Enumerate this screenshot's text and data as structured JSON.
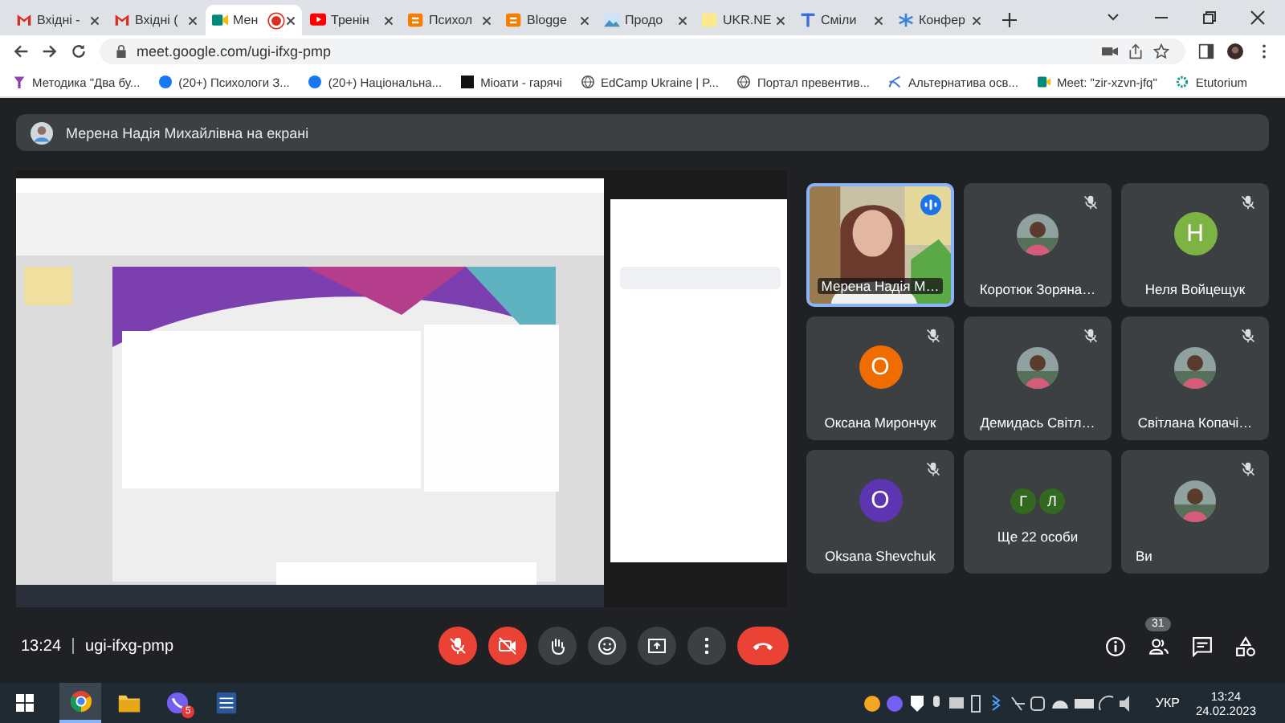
{
  "browser": {
    "tabs": [
      {
        "title": "Вхідні -",
        "selected": false,
        "recording": false
      },
      {
        "title": "Вхідні (",
        "selected": false,
        "recording": false
      },
      {
        "title": "Мен",
        "selected": true,
        "recording": true
      },
      {
        "title": "Тренін",
        "selected": false,
        "recording": false
      },
      {
        "title": "Психол",
        "selected": false,
        "recording": false
      },
      {
        "title": "Blogge",
        "selected": false,
        "recording": false
      },
      {
        "title": "Продо",
        "selected": false,
        "recording": false
      },
      {
        "title": "UKR.NE",
        "selected": false,
        "recording": false
      },
      {
        "title": "Сміли",
        "selected": false,
        "recording": false
      },
      {
        "title": "Конфер",
        "selected": false,
        "recording": false
      }
    ],
    "url": "meet.google.com/ugi-ifxg-pmp",
    "bookmarks": [
      "Методика \"Два бу...",
      "(20+) Психологи З...",
      "(20+) Національна...",
      "Міоати - гарячі",
      "EdCamp Ukraine | P...",
      "Портал превентив...",
      "Альтернатива осв...",
      "Meet: \"zir-xzvn-jfq\"",
      "Etutorium"
    ]
  },
  "meet": {
    "presenter_banner": "Мерена Надія Михайлівна на екрані",
    "tiles": [
      {
        "kind": "video",
        "name": "Мерена Надія М…",
        "muted": false,
        "speaking": true,
        "selected": true
      },
      {
        "name": "Коротюк Зоряна…",
        "muted": true,
        "speaking": false,
        "selected": false
      },
      {
        "kind": "letter",
        "letter": "Н",
        "color": "#7cb342",
        "name": "Неля Войцещук",
        "muted": true,
        "speaking": false,
        "selected": false
      },
      {
        "kind": "letter",
        "letter": "О",
        "color": "#ef6c00",
        "name": "Оксана Мирончук",
        "muted": true,
        "speaking": false,
        "selected": false
      },
      {
        "name": "Демидась Світл…",
        "muted": true,
        "speaking": false,
        "selected": false
      },
      {
        "name": "Світлана Копачі…",
        "muted": true,
        "speaking": false,
        "selected": false
      },
      {
        "kind": "letter",
        "letter": "О",
        "color": "#5e35b1",
        "name": "Oksana Shevchuk",
        "muted": true,
        "speaking": false,
        "selected": false
      },
      {
        "kind": "group",
        "letters": [
          "Г",
          "Л"
        ],
        "name": "Ще 22 особи",
        "muted": false,
        "speaking": false,
        "selected": false
      },
      {
        "name": "Ви",
        "muted": true,
        "speaking": false,
        "selected": false
      }
    ],
    "time": "13:24",
    "meeting_code": "ugi-ifxg-pmp",
    "mic": {
      "on": false
    },
    "camera": {
      "on": false
    },
    "actions": [
      {
        "kind": "hand"
      },
      {
        "kind": "emoji"
      },
      {
        "kind": "present"
      },
      {
        "kind": "more"
      },
      {
        "kind": "hangup"
      }
    ],
    "people_count": "31"
  },
  "taskbar": {
    "apps": [
      {
        "kind": "chrome",
        "active": true
      },
      {
        "kind": "folder",
        "active": false
      },
      {
        "kind": "viber",
        "active": false
      },
      {
        "kind": "word",
        "active": false
      }
    ],
    "viber_badge": "5",
    "language": "УКР",
    "time": "13:24",
    "date": "24.02.2023"
  }
}
